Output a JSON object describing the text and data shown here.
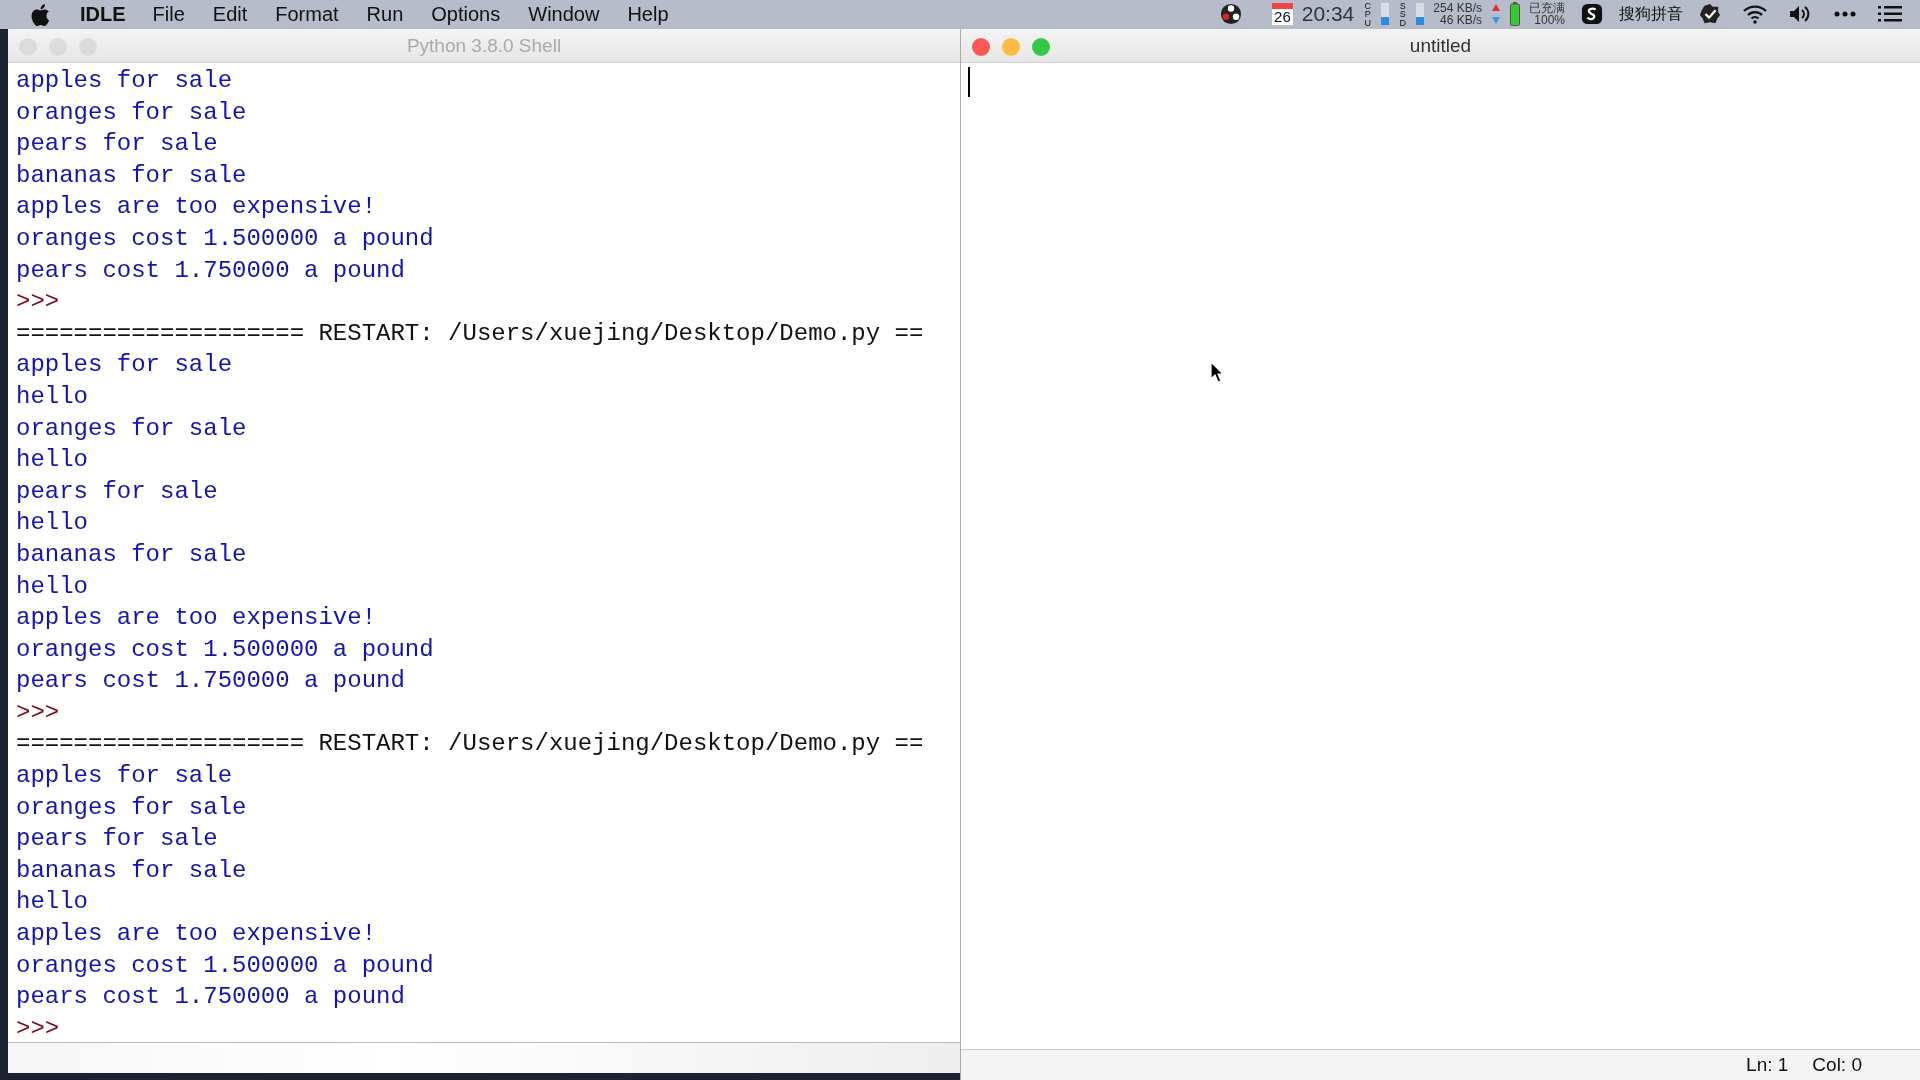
{
  "menu_bar": {
    "app_name": "IDLE",
    "menus": [
      "File",
      "Edit",
      "Format",
      "Run",
      "Options",
      "Window",
      "Help"
    ],
    "status": {
      "calendar_day": "26",
      "clock": "20:34",
      "cpu_label": "CPU",
      "ssd_label": "SSD",
      "upload_rate": "254 KB/s",
      "download_rate": "46 KB/s",
      "battery_state": "已充满",
      "battery_percent": "100%",
      "input_method": "搜狗拼音"
    }
  },
  "shell_window": {
    "title": "Python 3.8.0 Shell",
    "active": false,
    "lines": [
      {
        "kind": "output",
        "text": "apples for sale"
      },
      {
        "kind": "output",
        "text": "oranges for sale"
      },
      {
        "kind": "output",
        "text": "pears for sale"
      },
      {
        "kind": "output",
        "text": "bananas for sale"
      },
      {
        "kind": "output",
        "text": "apples are too expensive!"
      },
      {
        "kind": "output",
        "text": "oranges cost 1.500000 a pound"
      },
      {
        "kind": "output",
        "text": "pears cost 1.750000 a pound"
      },
      {
        "kind": "prompt",
        "text": ">>>"
      },
      {
        "kind": "restart",
        "text": "==================== RESTART: /Users/xuejing/Desktop/Demo.py =="
      },
      {
        "kind": "output",
        "text": "apples for sale"
      },
      {
        "kind": "output",
        "text": "hello"
      },
      {
        "kind": "output",
        "text": "oranges for sale"
      },
      {
        "kind": "output",
        "text": "hello"
      },
      {
        "kind": "output",
        "text": "pears for sale"
      },
      {
        "kind": "output",
        "text": "hello"
      },
      {
        "kind": "output",
        "text": "bananas for sale"
      },
      {
        "kind": "output",
        "text": "hello"
      },
      {
        "kind": "output",
        "text": "apples are too expensive!"
      },
      {
        "kind": "output",
        "text": "oranges cost 1.500000 a pound"
      },
      {
        "kind": "output",
        "text": "pears cost 1.750000 a pound"
      },
      {
        "kind": "prompt",
        "text": ">>>"
      },
      {
        "kind": "restart",
        "text": "==================== RESTART: /Users/xuejing/Desktop/Demo.py =="
      },
      {
        "kind": "output",
        "text": "apples for sale"
      },
      {
        "kind": "output",
        "text": "oranges for sale"
      },
      {
        "kind": "output",
        "text": "pears for sale"
      },
      {
        "kind": "output",
        "text": "bananas for sale"
      },
      {
        "kind": "output",
        "text": "hello"
      },
      {
        "kind": "output",
        "text": "apples are too expensive!"
      },
      {
        "kind": "output",
        "text": "oranges cost 1.500000 a pound"
      },
      {
        "kind": "output",
        "text": "pears cost 1.750000 a pound"
      },
      {
        "kind": "prompt",
        "text": ">>>"
      }
    ]
  },
  "editor_window": {
    "title": "untitled",
    "active": true,
    "line_number": "Ln: 1",
    "column": "Col: 0"
  }
}
